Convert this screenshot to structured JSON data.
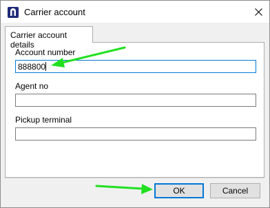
{
  "window": {
    "title": "Carrier account",
    "app_icon": "carrier-app-icon",
    "close_icon": "close-icon"
  },
  "tabs": [
    {
      "label": "Carrier account details",
      "selected": true
    }
  ],
  "form": {
    "account_number": {
      "label": "Account number",
      "value": "888800",
      "focused": true
    },
    "agent_no": {
      "label": "Agent no",
      "value": ""
    },
    "pickup_terminal": {
      "label": "Pickup terminal",
      "value": ""
    }
  },
  "buttons": {
    "ok_label": "OK",
    "cancel_label": "Cancel"
  },
  "annotations": {
    "arrow_color": "#21e021"
  },
  "colors": {
    "focus_border": "#0078d7",
    "app_icon": "#1e2a78"
  }
}
